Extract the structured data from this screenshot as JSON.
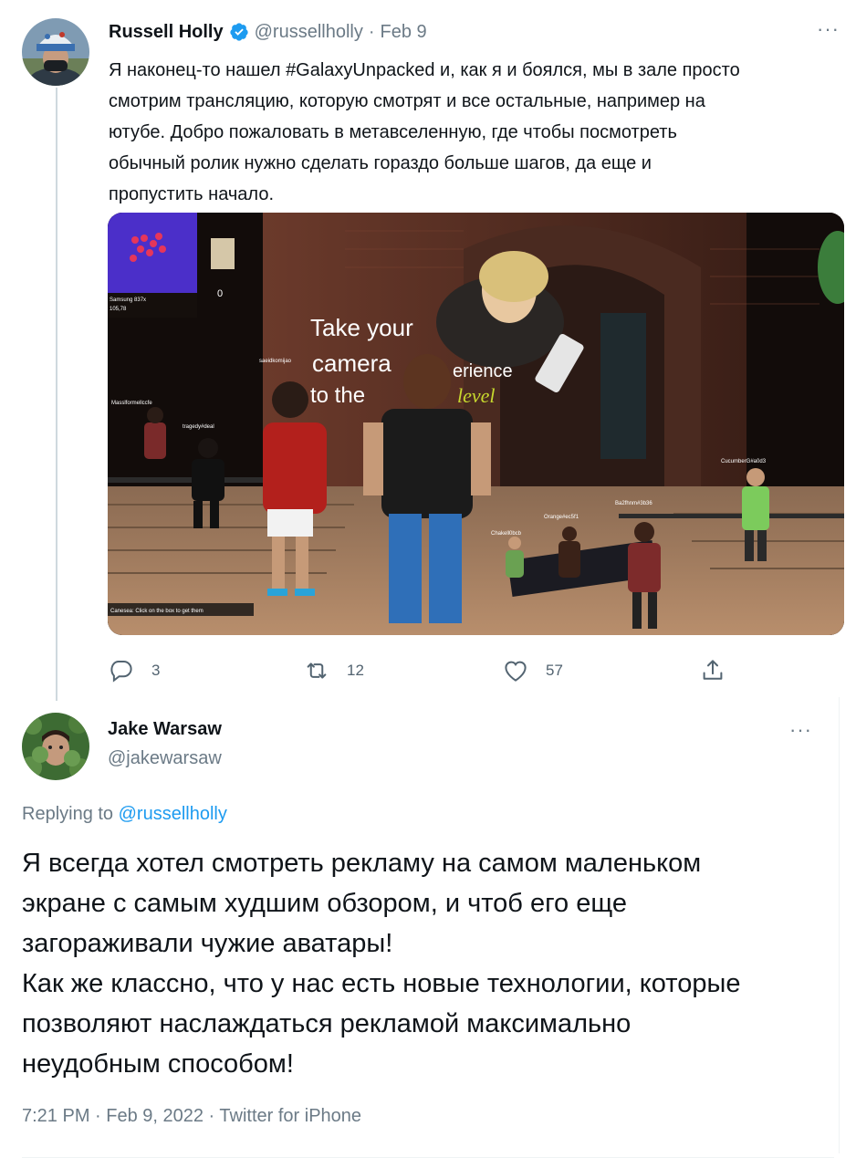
{
  "colors": {
    "text_primary": "#0f1419",
    "text_secondary": "#6b7a86",
    "link": "#1d9bf0",
    "verified": "#1d9bf0"
  },
  "tweet1": {
    "author_name": "Russell Holly",
    "author_handle": "@russellholly",
    "separator": "·",
    "date": "Feb 9",
    "verified_icon": "verified-badge-icon",
    "more_icon": "more-icon",
    "more_glyph": "···",
    "text": "Я наконец-то нашел #GalaxyUnpacked и, как я и боялся, мы в зале просто\nсмотрим трансляцию, которую смотрят и все остальные, например на\nютубе. Добро пожаловать в метавселенную, где чтобы посмотреть\nобычный ролик нужно сделать гораздо больше шагов, да еще и\nпропустить начало.",
    "media": {
      "description_icon": "metaverse-screenshot-image",
      "billboard_lines": [
        "Take your",
        "camera",
        "erience",
        "to the",
        "level"
      ],
      "hud_label_1": "Samsung 837x",
      "hud_label_2": "105,78",
      "hud_counter": "0",
      "avatar_names": [
        "Masslformellccfe",
        "tragedy#deal",
        "saeidkomijao",
        "CucumberG#a0d3",
        "Ba2fhnm#3b36",
        "Orange#ec5f1",
        "Chakell0bcb"
      ],
      "bottom_hint": "Canesea: Click on the box to get them"
    },
    "actions": {
      "reply_count": "3",
      "retweet_count": "12",
      "like_count": "57"
    }
  },
  "tweet2": {
    "author_name": "Jake Warsaw",
    "author_handle": "@jakewarsaw",
    "more_glyph": "···",
    "replying_prefix": "Replying to",
    "replying_mention": "@russellholly",
    "text": "Я всегда хотел смотреть рекламу на самом маленьком\nэкране с самым худшим обзором, и чтоб его еще\nзагораживали чужие аватары!\nКак же классно, что у нас есть новые технологии, которые\nпозволяют наслаждаться рекламой максимально\nнеудобным способом!",
    "meta": "7:21 PM · Feb 9, 2022 · Twitter for iPhone"
  }
}
